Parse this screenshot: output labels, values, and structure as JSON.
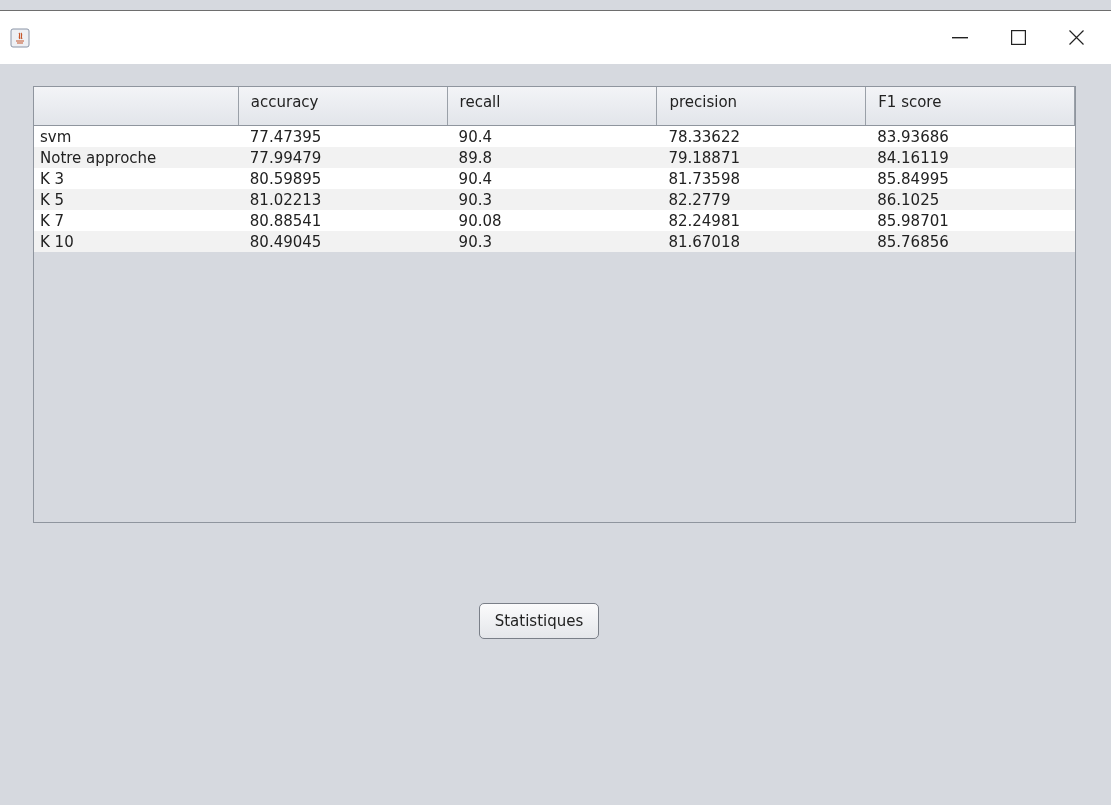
{
  "table": {
    "columns": [
      "",
      "accuracy",
      "recall",
      "precision",
      "F1 score"
    ],
    "rows": [
      [
        "svm",
        "77.47395",
        "90.4",
        "78.33622",
        "83.93686"
      ],
      [
        "Notre approche",
        "77.99479",
        "89.8",
        "79.18871",
        "84.16119"
      ],
      [
        "K 3",
        "80.59895",
        "90.4",
        "81.73598",
        "85.84995"
      ],
      [
        "K 5",
        "81.02213",
        "90.3",
        "82.2779",
        "86.1025"
      ],
      [
        "K 7",
        "80.88541",
        "90.08",
        "82.24981",
        "85.98701"
      ],
      [
        "K 10",
        "80.49045",
        "90.3",
        "81.67018",
        "85.76856"
      ]
    ]
  },
  "buttons": [
    "Statistiques"
  ]
}
